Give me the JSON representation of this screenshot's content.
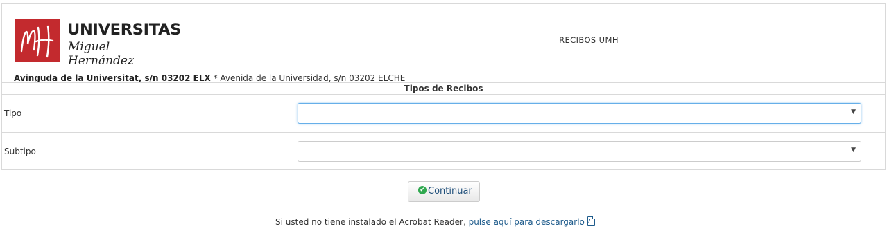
{
  "header": {
    "logo_line1": "UNIVERSITAS",
    "logo_line2": "Miguel Hernández",
    "title": "RECIBOS UMH",
    "address_bold": "Avinguda de la Universitat, s/n 03202 ELX",
    "address_rest": " * Avenida de la Universidad, s/n 03202 ELCHE"
  },
  "form": {
    "section_title": "Tipos de Recibos",
    "tipo": {
      "label": "Tipo",
      "value": ""
    },
    "subtipo": {
      "label": "Subtipo",
      "value": ""
    },
    "continue_label": "Continuar"
  },
  "footer": {
    "text": "Si usted no tiene instalado el Acrobat Reader, ",
    "link": "pulse aquí para descargarlo"
  },
  "colors": {
    "brand_red": "#c32a2e",
    "link": "#1f5c8c",
    "focus": "#66afe9",
    "success": "#2fa84f"
  },
  "icons": [
    "check-circle-icon",
    "pdf-file-icon",
    "caret-down-icon"
  ]
}
